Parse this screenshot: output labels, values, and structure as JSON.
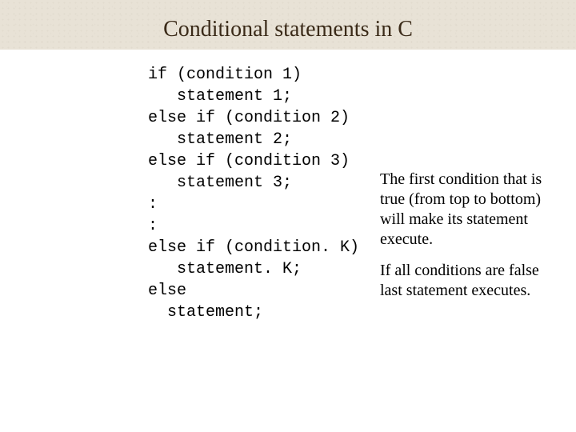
{
  "title": "Conditional statements in C",
  "code": "if (condition 1)\n   statement 1;\nelse if (condition 2)\n   statement 2;\nelse if (condition 3)\n   statement 3;\n:\n:\nelse if (condition. K)\n   statement. K;\nelse\n  statement;",
  "notes": {
    "p1": "The first condition that is true (from top to bottom) will make its statement execute.",
    "p2": "If all conditions are false last statement executes."
  }
}
